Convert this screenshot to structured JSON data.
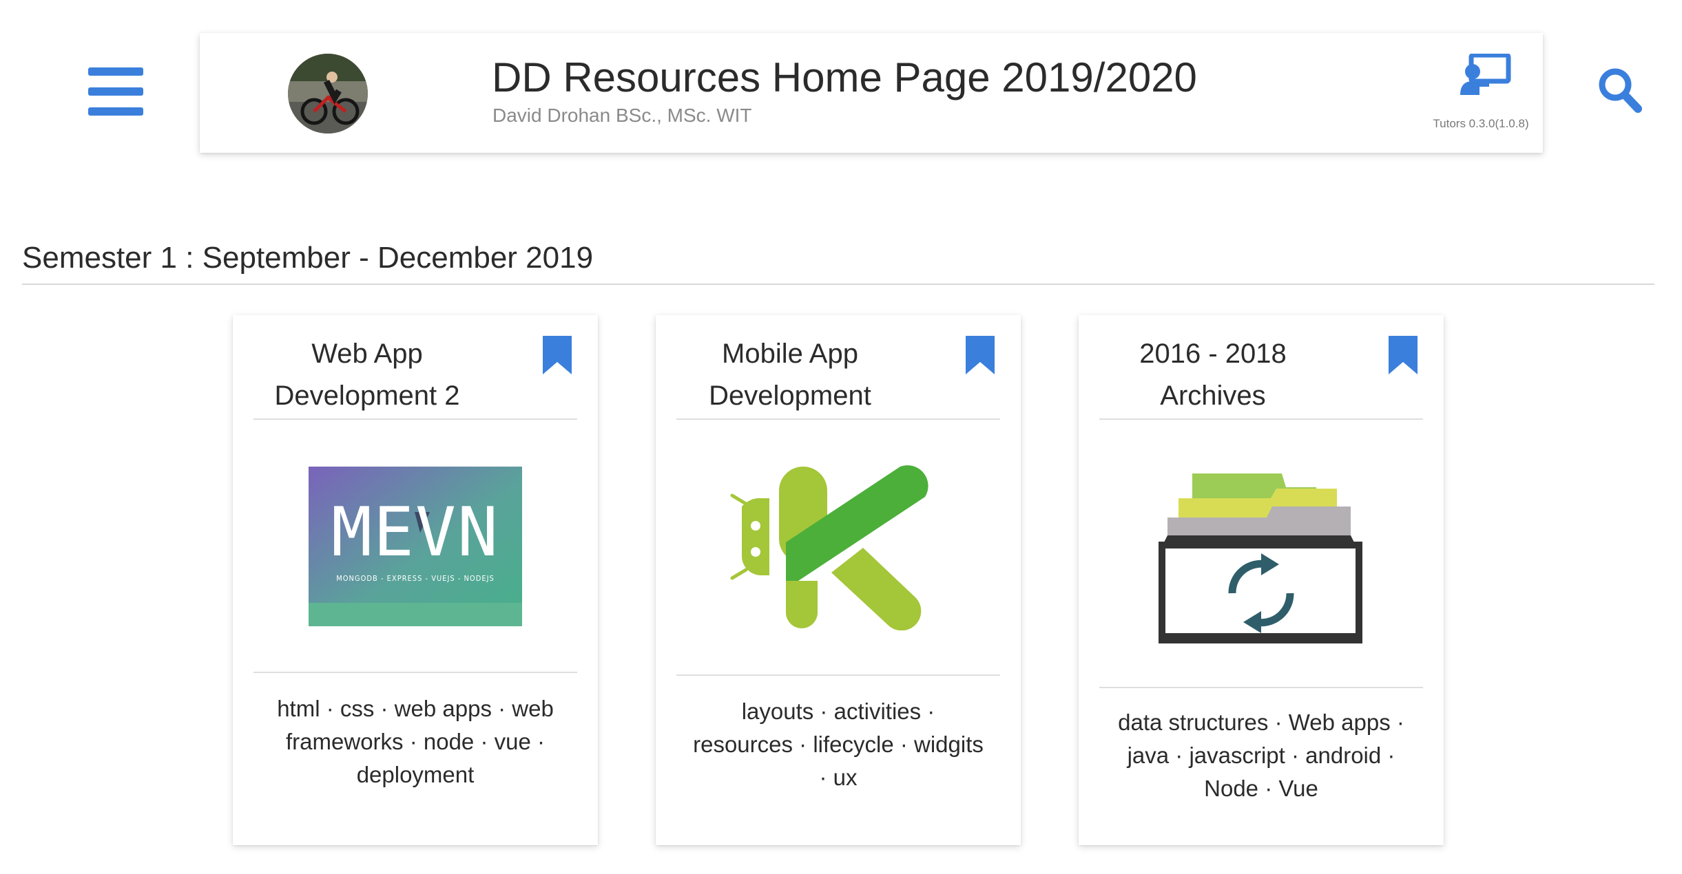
{
  "header": {
    "title": "DD Resources Home Page 2019/2020",
    "subtitle": "David Drohan BSc., MSc. WIT",
    "tutors_version": "Tutors 0.3.0(1.0.8)"
  },
  "icons": {
    "menu": "hamburger-menu-icon",
    "search": "search-icon",
    "tutors": "tutors-presentation-icon",
    "bookmark": "bookmark-icon"
  },
  "colors": {
    "accent": "#3a7fdc",
    "android_green": "#a4c639",
    "android_dark_green": "#4caf3a"
  },
  "semester": {
    "title": "Semester 1 : September - December 2019"
  },
  "cards": [
    {
      "title_line1": "Web App",
      "title_line2": "Development 2",
      "image": {
        "logo_text": "MEVN",
        "logo_subtitle": "MONGODB - EXPRESS - VUEJS - NODEJS"
      },
      "tags": "html · css · web apps · web frameworks · node · vue · deployment"
    },
    {
      "title_line1": "Mobile App",
      "title_line2": "Development",
      "image": {
        "icon": "android-kotlin-logo"
      },
      "tags": "layouts · activities · resources · lifecycle · widgits · ux"
    },
    {
      "title_line1": "2016 - 2018",
      "title_line2": "Archives",
      "image": {
        "icon": "archive-box-icon"
      },
      "tags": "data structures · Web apps · java · javascript · android · Node · Vue"
    }
  ]
}
